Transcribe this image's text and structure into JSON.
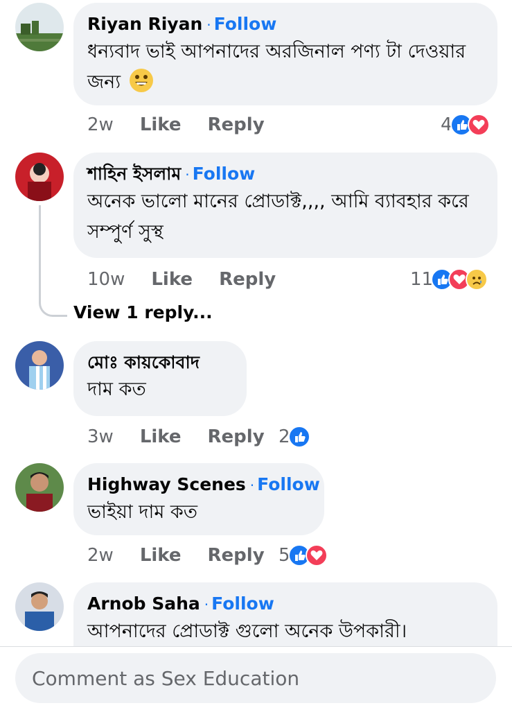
{
  "comments": [
    {
      "author": "Riyan Riyan",
      "follow": "Follow",
      "text": "ধন্যবাদ ভাই আপনাদের অরজিনাল পণ্য টা দেওয়ার জন্য",
      "emoji": "grinning-face",
      "time": "2w",
      "like": "Like",
      "reply": "Reply",
      "reactions_count": "4",
      "reactions": [
        "like",
        "love"
      ]
    },
    {
      "author": "শাহিন ইসলাম",
      "follow": "Follow",
      "text": "অনেক ভালো মানের প্রোডাক্ট,,,, আমি ব্যাবহার করে সম্পুর্ণ সুস্থ",
      "time": "10w",
      "like": "Like",
      "reply": "Reply",
      "reactions_count": "11",
      "reactions": [
        "like",
        "love",
        "sad"
      ],
      "view_replies": "View 1 reply..."
    },
    {
      "author": "মোঃ কায়কোবাদ",
      "text": "দাম কত",
      "time": "3w",
      "like": "Like",
      "reply": "Reply",
      "reactions_count": "2",
      "reactions": [
        "like"
      ]
    },
    {
      "author": "Highway Scenes",
      "follow": "Follow",
      "text": "ভাইয়া দাম কত",
      "time": "2w",
      "like": "Like",
      "reply": "Reply",
      "reactions_count": "5",
      "reactions": [
        "like",
        "love"
      ]
    },
    {
      "author": "Arnob Saha",
      "follow": "Follow",
      "text": "আপনাদের প্রোডাক্ট গুলো অনেক উপকারী।"
    }
  ],
  "composer": {
    "placeholder": "Comment as Sex Education"
  },
  "colors": {
    "accent": "#1877f2",
    "bubble": "#f0f2f5",
    "muted": "#65676b",
    "love": "#f33e58"
  }
}
